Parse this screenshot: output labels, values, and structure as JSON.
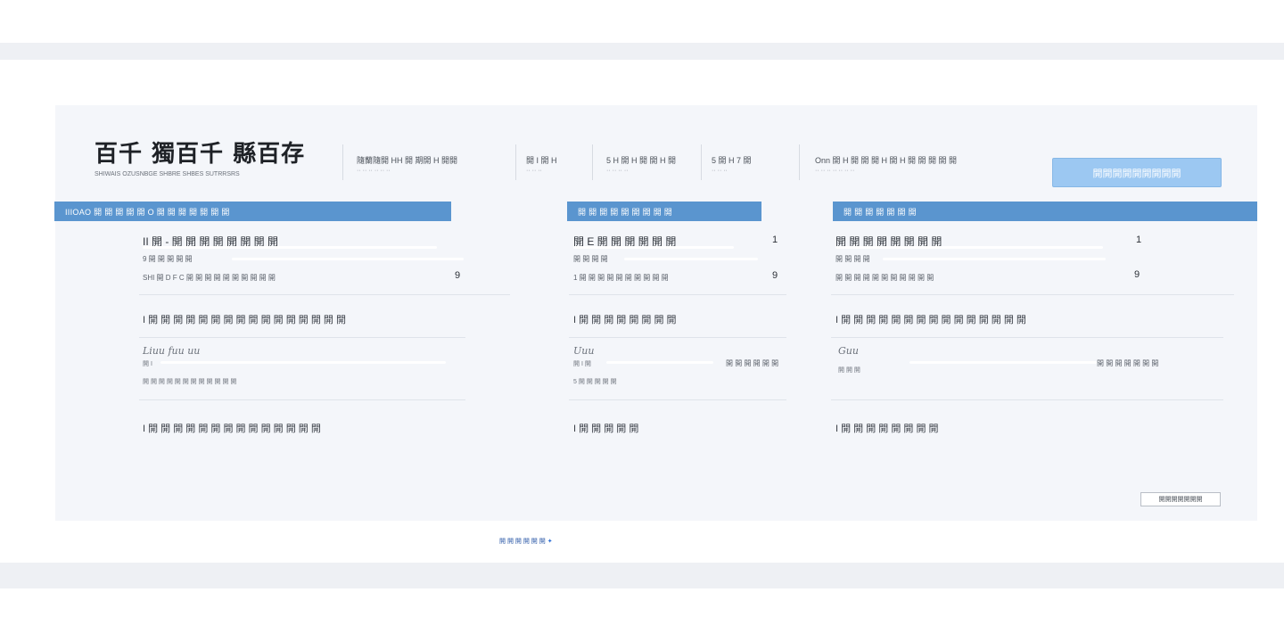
{
  "header": {
    "logo_text": "百千 獨百千 縣百存",
    "logo_subtitle": "SHIWAIS  OZUSNBGE SHBRE  SHBES SUTRRSRS",
    "meta": [
      {
        "line1": "隨蘭隨開 HH 開 期開 H 開開",
        "line2": "·· ·· ·· ·· ·· ··"
      },
      {
        "line1": "開 I 開 H",
        "line2": "·· ·· ··"
      },
      {
        "line1": "5 H 開 H 開 開 H 開",
        "line2": "·· ·· ·· ··"
      },
      {
        "line1": "5 開 H 7 開",
        "line2": "·· ·· ··"
      },
      {
        "line1": "Onn 開 H 開 開 開 H 開 H 開 開 開 開 開",
        "line2": "·· ·· ·· ·· ·· ·· ··"
      }
    ],
    "action_label": "開開開開開開開開開"
  },
  "columns": [
    {
      "head": "IIIOAO 開 開 開 開 開 O 開 開 開 開 開 開 開",
      "title": "II 開 - 開 開 開 開 開 開 開 開",
      "count": "",
      "line_a": "9 開 開 開 開 開",
      "line_b": "SHI 開 D F C 開 開 開 開 開 開 開 開 開 開",
      "value": "9",
      "section1": "I 開 開 開 開 開 開 開 開 開 開 開 開 開 開 開 開",
      "signature": "Liuu fuu uu",
      "sig_line1": "開 I",
      "sig_line2": "開 開 開 開 開 開 開 開 開 開 開 開",
      "sig_value": "",
      "section2": "I 開 開 開 開 開 開 開 開 開 開 開 開 開 開"
    },
    {
      "head": "開 開 開 開 開 開 開 開 開",
      "title": "開 E 開 開 開 開 開 開",
      "count": "1",
      "line_a": "開 開 開 開",
      "line_b": "1 開 開 開 開 開 開 開 開 開 開",
      "value": "9",
      "section1": "I 開 開 開 開 開 開 開 開",
      "signature": "Uuu",
      "sig_line1": "開 I 開",
      "sig_line2": "5 開 開 開 開 開",
      "sig_value": "開 開 開 開 開 開",
      "section2": "I 開 開 開 開 開"
    },
    {
      "head": "開 開 開 開 開 開 開",
      "title": "開 開 開 開 開 開 開 開",
      "count": "1",
      "line_a": "開 開 開 開",
      "line_b": "開 開 開 開 開 開 開 開 開 開 開",
      "value": "9",
      "section1": "I 開 開 開 開 開 開 開 開 開 開 開 開 開 開 開",
      "signature": "Guu",
      "sig_line1": "開 開 開",
      "sig_line2": "",
      "sig_value": "開 開 開 開 開 開 開",
      "section2": "I 開 開 開 開 開 開 開 開"
    }
  ],
  "footer": {
    "button_label": "開開開開開開開",
    "link_text": "開 開 開 開 開 開"
  },
  "colors": {
    "accent": "#5a95cf",
    "action": "#9cc8f2",
    "panel": "#f4f6fa"
  }
}
